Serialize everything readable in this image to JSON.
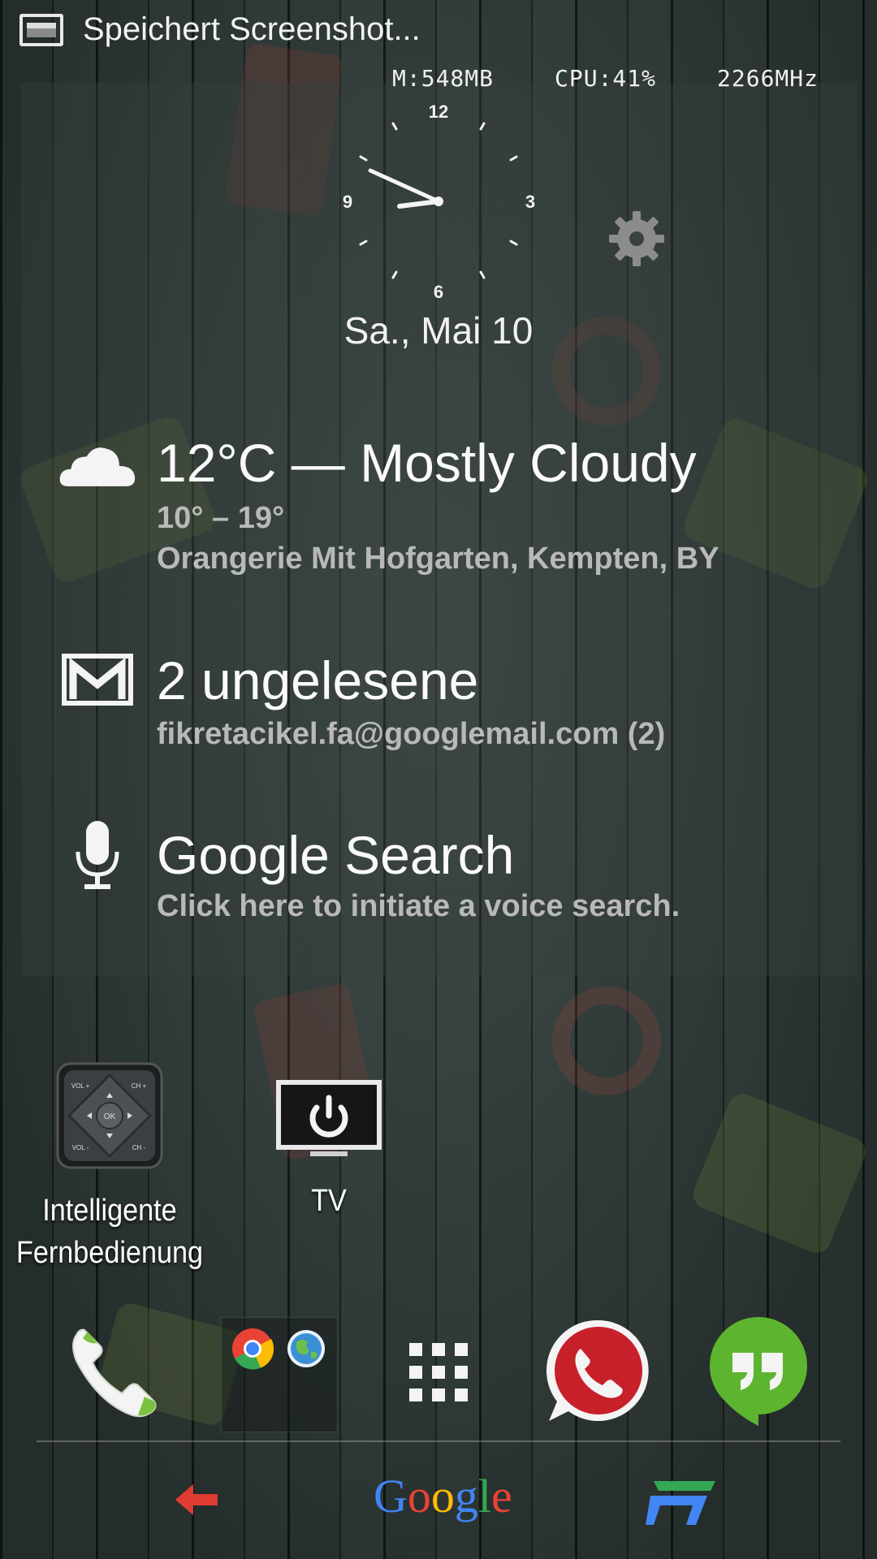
{
  "statusbar": {
    "notification_text": "Speichert Screenshot..."
  },
  "sysinfo": {
    "memory": "M:548MB",
    "cpu": "CPU:41%",
    "freq": "2266MHz"
  },
  "clock": {
    "num_12": "12",
    "num_3": "3",
    "num_6": "6",
    "num_9": "9",
    "date": "Sa., Mai 10"
  },
  "weather": {
    "title": "12°C — Mostly Cloudy",
    "range": "10° – 19°",
    "location": "Orangerie Mit Hofgarten, Kempten, BY"
  },
  "gmail": {
    "title": "2 ungelesene",
    "account": "fikretacikel.fa@googlemail.com (2)"
  },
  "voice_search": {
    "title": "Google Search",
    "subtitle": "Click here to initiate a voice search."
  },
  "apps": [
    {
      "label_line1": "Intelligente",
      "label_line2": "Fernbedienung",
      "icon": "remote-control-icon"
    },
    {
      "label_line1": "TV",
      "icon": "tv-power-icon"
    }
  ],
  "remote_icon_text": {
    "vol_plus": "VOL +",
    "ch_plus": "CH +",
    "ok": "OK",
    "vol_minus": "VOL -",
    "ch_minus": "CH -"
  },
  "dock": [
    {
      "name": "phone",
      "icon": "phone-icon"
    },
    {
      "name": "folder",
      "icon": "chrome-icon"
    },
    {
      "name": "app-drawer",
      "icon": "grid-icon"
    },
    {
      "name": "whatsapp",
      "icon": "whatsapp-icon"
    },
    {
      "name": "hangouts",
      "icon": "hangouts-icon"
    }
  ],
  "navbar": {
    "back_icon": "back-arrow-icon",
    "google_label": "Google",
    "recents_icon": "recents-icon"
  },
  "colors": {
    "google_blue": "#4285f4",
    "google_red": "#ea4335",
    "google_yellow": "#fbbc05",
    "google_green": "#34a853",
    "back_red": "#e03c31",
    "whatsapp_red": "#c8202a",
    "hangouts_green": "#5db52f"
  }
}
